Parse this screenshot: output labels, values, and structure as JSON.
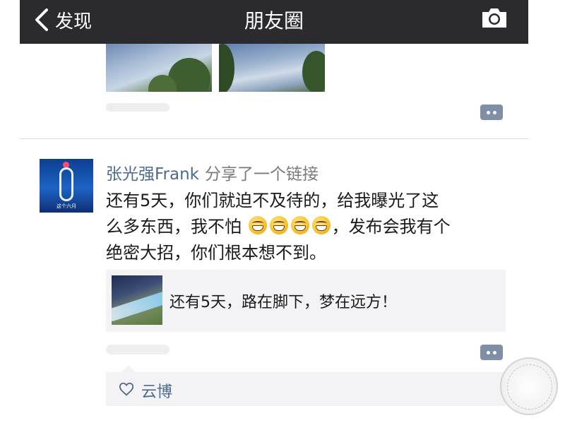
{
  "nav": {
    "back_label": "发现",
    "title": "朋友圈"
  },
  "post": {
    "author": "张光强Frank",
    "action": "分享了一个链接",
    "text_line1": "还有5天，你们就迫不及待的，给我曝光了这",
    "text_line2_before": "么多东西，我不怕",
    "text_line2_after": "，发布会我有个",
    "text_line3": "绝密大招，你们根本想不到。",
    "emoji_names": [
      "grin-emoji",
      "grin-emoji",
      "grin-emoji",
      "grin-emoji"
    ],
    "link_title": "还有5天，路在脚下，梦在远方！",
    "avatar_caption": "这个六月"
  },
  "likes": {
    "names": "云博"
  },
  "colors": {
    "navbar": "#2b2b2f",
    "author_blue": "#4f6a8f",
    "comment_button": "#7f8fa6",
    "card_bg": "#f3f3f5"
  }
}
